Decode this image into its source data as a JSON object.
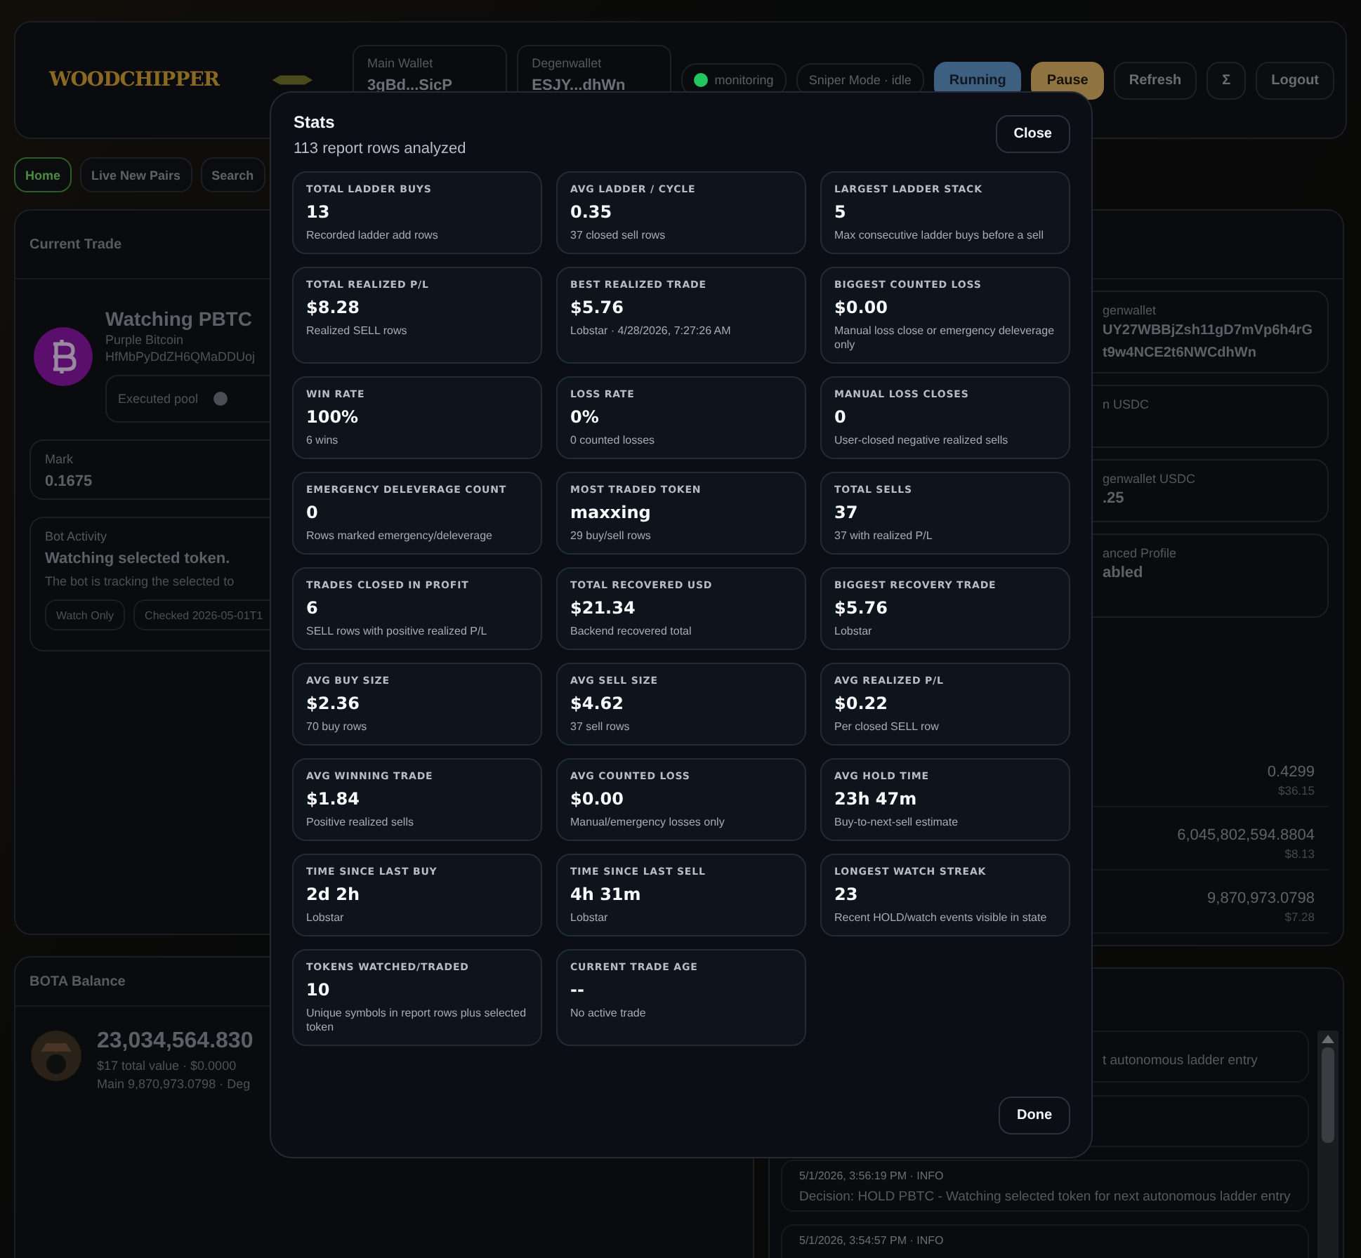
{
  "header": {
    "logo": "WOODCHIPPER",
    "wallets": [
      {
        "label": "Main Wallet",
        "value": "3gBd...SicP"
      },
      {
        "label": "Degenwallet",
        "value": "ESJY...dhWn"
      }
    ],
    "status": {
      "label": "monitoring",
      "color": "#22c55e"
    },
    "mode": "Sniper Mode · idle",
    "buttons": [
      {
        "label": "Running",
        "kind": "primary"
      },
      {
        "label": "Pause",
        "kind": "warning"
      },
      {
        "label": "Refresh",
        "kind": "plain"
      },
      {
        "label": "Σ",
        "kind": "plain"
      },
      {
        "label": "Logout",
        "kind": "plain"
      }
    ]
  },
  "nav": [
    {
      "label": "Home",
      "selected": true
    },
    {
      "label": "Live New Pairs",
      "selected": false
    },
    {
      "label": "Search",
      "selected": false
    }
  ],
  "current_trade": {
    "title": "Current Trade",
    "heading": "Watching PBTC",
    "token_name": "Purple Bitcoin",
    "address": "HfMbPyDdZH6QMaDDUoj",
    "pool_label": "Executed pool",
    "mark_label": "Mark",
    "mark": "0.1675",
    "activity_label": "Bot Activity",
    "activity_title": "Watching selected token.",
    "activity_text": "The bot is tracking the selected to",
    "chips": [
      "Watch Only",
      "Checked 2026-05-01T1"
    ]
  },
  "wallet_panel": {
    "wallet_label": "genwallet",
    "address_lines": [
      "UY27WBBjZsh11gD7mVp6h4rG",
      "t9w4NCE2t6NWCdhWn"
    ],
    "cards": [
      {
        "label": "n USDC"
      },
      {
        "label": "genwallet USDC",
        "value": ".25"
      },
      {
        "label": "anced Profile",
        "value": "abled"
      }
    ],
    "balances": [
      {
        "amount": "0.4299",
        "usd": "$36.15"
      },
      {
        "amount": "6,045,802,594.8804",
        "usd": "$8.13"
      },
      {
        "amount": "9,870,973.0798",
        "usd": "$7.28"
      }
    ]
  },
  "bota": {
    "title": "BOTA Balance",
    "amount": "23,034,564.830",
    "value_line": "$17 total value · $0.0000",
    "holdings_line": "Main 9,870,973.0798 · Deg"
  },
  "log": {
    "first_fragment": "t autonomous ladder entry",
    "entries": [
      {
        "meta": "5/1/2026, 3:56:19 PM · INFO",
        "message": "Decision: HOLD PBTC - Watching selected token for next autonomous ladder entry"
      },
      {
        "meta": "5/1/2026, 3:54:57 PM · INFO"
      }
    ]
  },
  "stats": {
    "title": "Stats",
    "subtitle": "113 report rows analyzed",
    "close": "Close",
    "done": "Done",
    "cards": [
      {
        "label": "TOTAL LADDER BUYS",
        "value": "13",
        "note": "Recorded ladder add rows"
      },
      {
        "label": "AVG LADDER / CYCLE",
        "value": "0.35",
        "note": "37 closed sell rows"
      },
      {
        "label": "LARGEST LADDER STACK",
        "value": "5",
        "note": "Max consecutive ladder buys before a sell"
      },
      {
        "label": "TOTAL REALIZED P/L",
        "value": "$8.28",
        "note": "Realized SELL rows"
      },
      {
        "label": "BEST REALIZED TRADE",
        "value": "$5.76",
        "note": "Lobstar · 4/28/2026, 7:27:26 AM"
      },
      {
        "label": "BIGGEST COUNTED LOSS",
        "value": "$0.00",
        "note": "Manual loss close or emergency deleverage only"
      },
      {
        "label": "WIN RATE",
        "value": "100%",
        "note": "6 wins"
      },
      {
        "label": "LOSS RATE",
        "value": "0%",
        "note": "0 counted losses"
      },
      {
        "label": "MANUAL LOSS CLOSES",
        "value": "0",
        "note": "User-closed negative realized sells"
      },
      {
        "label": "EMERGENCY DELEVERAGE COUNT",
        "value": "0",
        "note": "Rows marked emergency/deleverage"
      },
      {
        "label": "MOST TRADED TOKEN",
        "value": "maxxing",
        "note": "29 buy/sell rows"
      },
      {
        "label": "TOTAL SELLS",
        "value": "37",
        "note": "37 with realized P/L"
      },
      {
        "label": "TRADES CLOSED IN PROFIT",
        "value": "6",
        "note": "SELL rows with positive realized P/L"
      },
      {
        "label": "TOTAL RECOVERED USD",
        "value": "$21.34",
        "note": "Backend recovered total"
      },
      {
        "label": "BIGGEST RECOVERY TRADE",
        "value": "$5.76",
        "note": "Lobstar"
      },
      {
        "label": "AVG BUY SIZE",
        "value": "$2.36",
        "note": "70 buy rows"
      },
      {
        "label": "AVG SELL SIZE",
        "value": "$4.62",
        "note": "37 sell rows"
      },
      {
        "label": "AVG REALIZED P/L",
        "value": "$0.22",
        "note": "Per closed SELL row"
      },
      {
        "label": "AVG WINNING TRADE",
        "value": "$1.84",
        "note": "Positive realized sells"
      },
      {
        "label": "AVG COUNTED LOSS",
        "value": "$0.00",
        "note": "Manual/emergency losses only"
      },
      {
        "label": "AVG HOLD TIME",
        "value": "23h 47m",
        "note": "Buy-to-next-sell estimate"
      },
      {
        "label": "TIME SINCE LAST BUY",
        "value": "2d 2h",
        "note": "Lobstar"
      },
      {
        "label": "TIME SINCE LAST SELL",
        "value": "4h 31m",
        "note": "Lobstar"
      },
      {
        "label": "LONGEST WATCH STREAK",
        "value": "23",
        "note": "Recent HOLD/watch events visible in state"
      },
      {
        "label": "TOKENS WATCHED/TRADED",
        "value": "10",
        "note": "Unique symbols in report rows plus selected token"
      },
      {
        "label": "CURRENT TRADE AGE",
        "value": "--",
        "note": "No active trade"
      }
    ]
  }
}
